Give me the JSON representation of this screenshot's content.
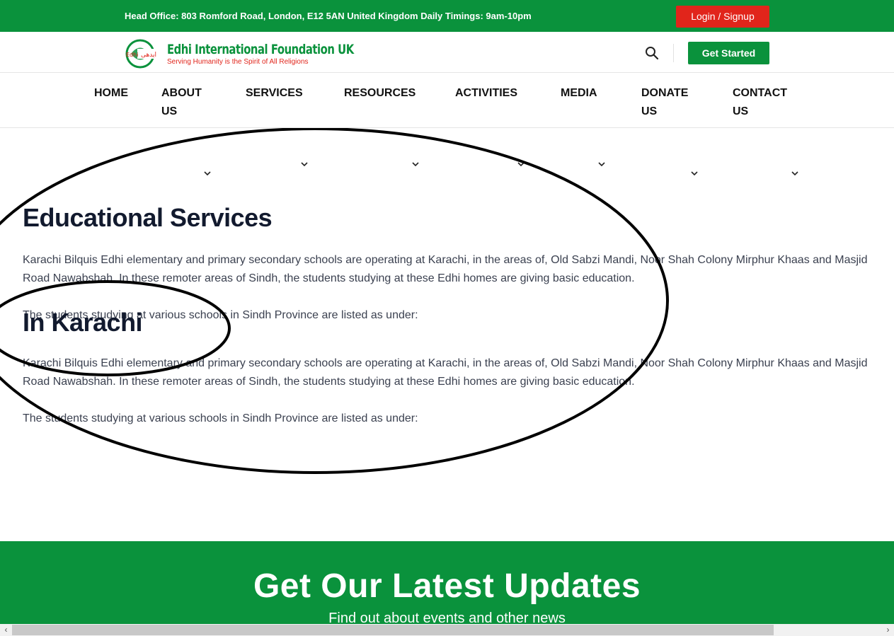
{
  "topbar": {
    "office_text": "Head Office: 803 Romford Road, London, E12 5AN United Kingdom Daily Timings: 9am-10pm",
    "login_label": "Login / Signup"
  },
  "header": {
    "logo_urdu": "ایدھی",
    "logo_latin": "Edhi",
    "logo_name": "Edhi International Foundation UK",
    "logo_tagline": "Serving Humanity is the Spirit of All Religions",
    "search_icon": "search-icon",
    "get_started_label": "Get Started"
  },
  "nav": {
    "items": [
      {
        "line1": "HOME",
        "line2": ""
      },
      {
        "line1": "ABOUT",
        "line2": "US"
      },
      {
        "line1": "SERVICES",
        "line2": ""
      },
      {
        "line1": "RESOURCES",
        "line2": ""
      },
      {
        "line1": "ACTIVITIES",
        "line2": ""
      },
      {
        "line1": "MEDIA",
        "line2": ""
      },
      {
        "line1": "DONATE",
        "line2": "US"
      },
      {
        "line1": "CONTACT",
        "line2": "US"
      }
    ]
  },
  "main": {
    "heading1": "Educational Services",
    "para1": "Karachi Bilquis Edhi elementary and primary secondary schools are operating at Karachi, in the areas of, Old Sabzi Mandi, Noor Shah Colony Mirphur Khaas and Masjid Road Nawabshah. In these remoter areas of Sindh, the students studying at these Edhi homes are giving basic education.",
    "para2": "The students studying at various schools in Sindh Province are listed as under:",
    "heading2": "In Karachi",
    "para3": "Karachi Bilquis Edhi elementary and primary secondary schools are operating at Karachi, in the areas of, Old Sabzi Mandi, Noor Shah Colony Mirphur Khaas and Masjid Road Nawabshah. In these remoter areas of Sindh, the students studying at these Edhi homes are giving basic education.",
    "para4": "The students studying at various schools in Sindh Province are listed as under:"
  },
  "footer": {
    "title": "Get Our Latest Updates",
    "subtitle": "Find out about events and other news"
  },
  "colors": {
    "brand_green": "#0a923c",
    "login_red": "#e1251b",
    "heading_dark": "#121a2e"
  }
}
